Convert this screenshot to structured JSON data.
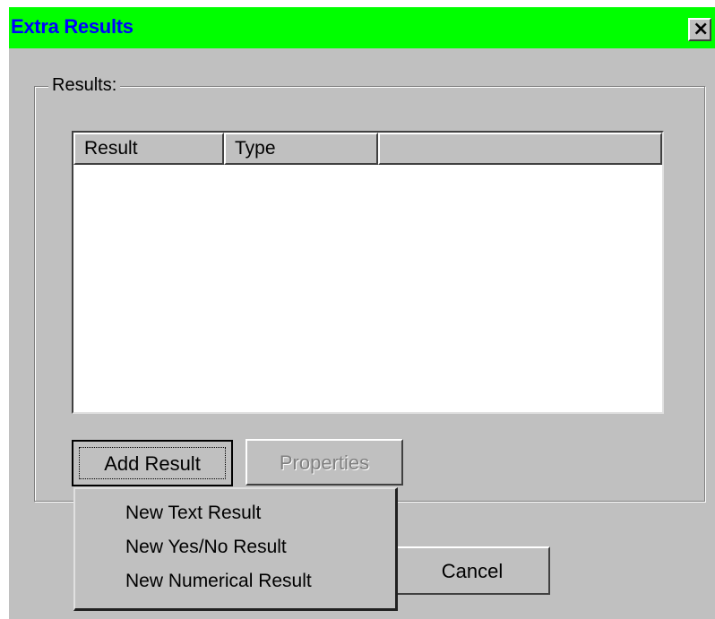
{
  "window": {
    "title": "Extra Results",
    "close_glyph": "✕",
    "accent_color": "#00ff00",
    "title_color": "#0000ff"
  },
  "results_group": {
    "label": "Results:",
    "columns": [
      "Result",
      "Type",
      ""
    ],
    "rows": []
  },
  "buttons": {
    "add_result": "Add Result",
    "properties": "Properties",
    "cancel": "Cancel"
  },
  "add_menu": {
    "items": [
      "New Text Result",
      "New Yes/No Result",
      "New Numerical Result"
    ]
  }
}
